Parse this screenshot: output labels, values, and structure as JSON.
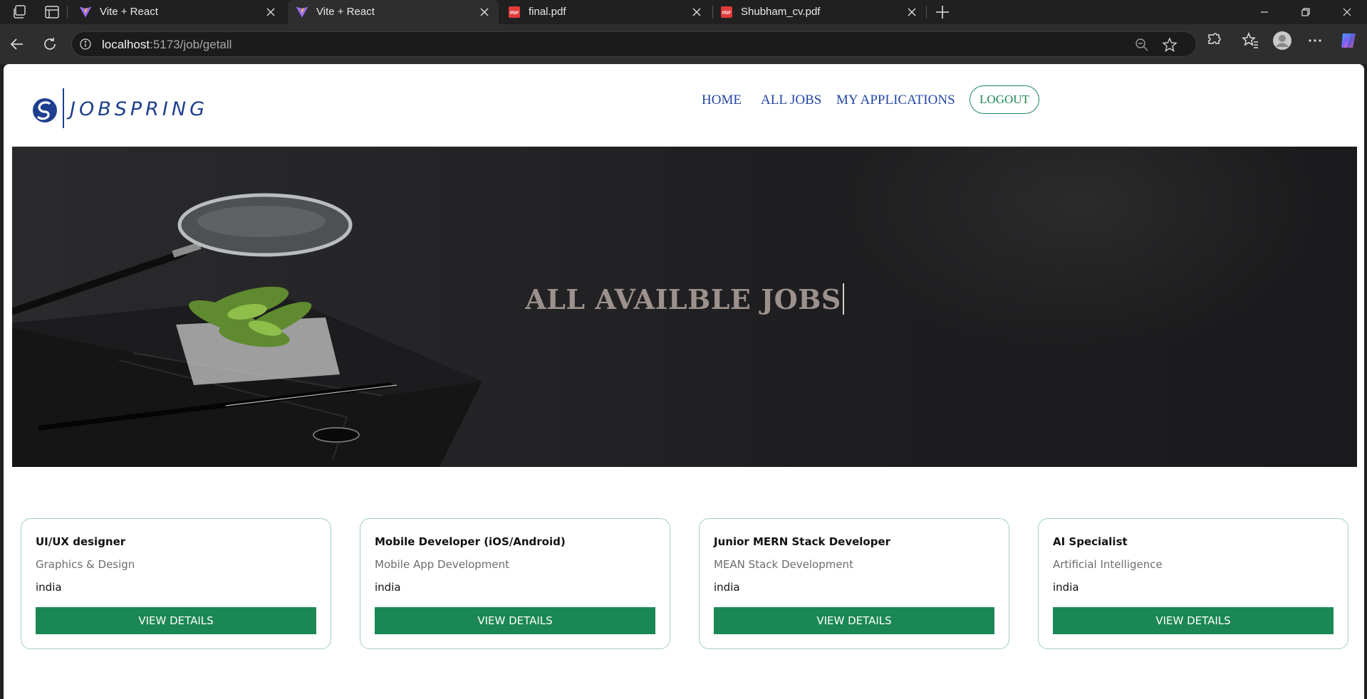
{
  "browser": {
    "tabs": [
      {
        "title": "Vite + React",
        "icon": "vite-icon",
        "active": false
      },
      {
        "title": "Vite + React",
        "icon": "vite-icon",
        "active": true
      },
      {
        "title": "final.pdf",
        "icon": "pdf-icon",
        "active": false
      },
      {
        "title": "Shubham_cv.pdf",
        "icon": "pdf-icon",
        "active": false
      }
    ],
    "url_host": "localhost",
    "url_path": ":5173/job/getall"
  },
  "site": {
    "logo_text": "JOBSPRING",
    "nav": {
      "home": "HOME",
      "all_jobs": "ALL JOBS",
      "my_applications": "MY APPLICATIONS",
      "logout": "LOGOUT"
    },
    "hero_title": "ALL AVAILBLE JOBS"
  },
  "jobs": [
    {
      "title": "UI/UX designer",
      "category": "Graphics & Design",
      "location": "india",
      "button": "VIEW DETAILS"
    },
    {
      "title": "Mobile Developer (iOS/Android)",
      "category": "Mobile App Development",
      "location": "india",
      "button": "VIEW DETAILS"
    },
    {
      "title": "Junior MERN Stack Developer",
      "category": "MEAN Stack Development",
      "location": "india",
      "button": "VIEW DETAILS"
    },
    {
      "title": "AI Specialist",
      "category": "Artificial Intelligence",
      "location": "india",
      "button": "VIEW DETAILS"
    }
  ],
  "colors": {
    "brand_blue": "#1e3f8f",
    "nav_blue": "#2346a4",
    "accent_green": "#1b8754",
    "card_border": "#9fd0c0"
  }
}
